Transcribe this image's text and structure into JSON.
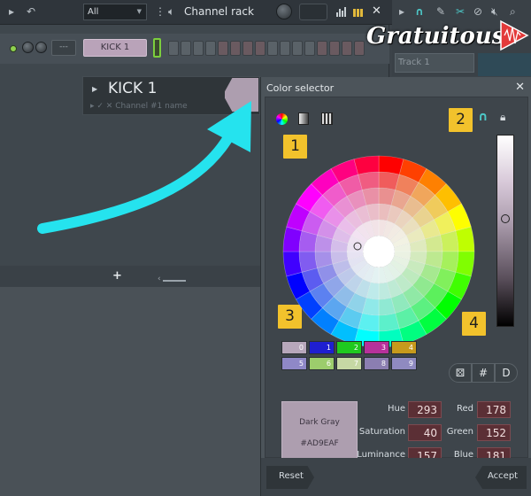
{
  "toolbar": {
    "filter_value": "All",
    "title": "Channel rack"
  },
  "channel": {
    "button_label": "KICK 1",
    "mixer_label": "---"
  },
  "name_popup": {
    "name": "KICK 1",
    "placeholder": "Channel #1 name"
  },
  "playlist": {
    "track_label": "Track 1"
  },
  "logo": {
    "text": "Gratuitous"
  },
  "color_selector": {
    "title": "Color selector",
    "palette": [
      {
        "n": "0",
        "color": "#b7a7bb"
      },
      {
        "n": "1",
        "color": "#1f1fd0"
      },
      {
        "n": "2",
        "color": "#1fc91f"
      },
      {
        "n": "3",
        "color": "#b7319b"
      },
      {
        "n": "4",
        "color": "#c79a1c"
      },
      {
        "n": "5",
        "color": "#8f88c7"
      },
      {
        "n": "6",
        "color": "#9ccd6c"
      },
      {
        "n": "7",
        "color": "#c6d8a4"
      },
      {
        "n": "8",
        "color": "#8b7eb1"
      },
      {
        "n": "9",
        "color": "#8f8ac0"
      }
    ],
    "buttons": {
      "random": "⚄",
      "hex": "#",
      "default": "D"
    },
    "current": {
      "name": "Dark Gray",
      "hex": "#AD9EAF",
      "color": "#ad9eaf"
    },
    "values": {
      "hue_label": "Hue",
      "hue": "293",
      "sat_label": "Saturation",
      "sat": "40",
      "lum_label": "Luminance",
      "lum": "157",
      "red_label": "Red",
      "red": "178",
      "green_label": "Green",
      "green": "152",
      "blue_label": "Blue",
      "blue": "181"
    },
    "reset_label": "Reset",
    "accept_label": "Accept"
  },
  "badges": [
    "1",
    "2",
    "3",
    "4"
  ]
}
